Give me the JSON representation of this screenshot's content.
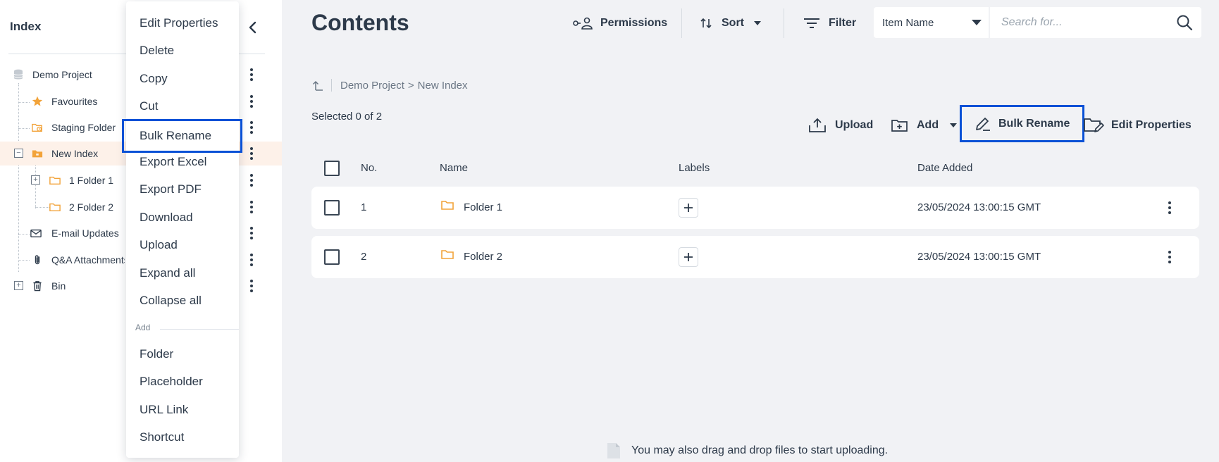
{
  "sidebar": {
    "title": "Index",
    "items": [
      {
        "label": "Demo Project"
      },
      {
        "label": "Favourites"
      },
      {
        "label": "Staging Folder"
      },
      {
        "label": "New Index"
      },
      {
        "label": "1 Folder 1"
      },
      {
        "label": "2 Folder 2"
      },
      {
        "label": "E-mail Updates"
      },
      {
        "label": "Q&A Attachments"
      },
      {
        "label": "Bin"
      }
    ]
  },
  "context_menu": {
    "items": [
      "Edit Properties",
      "Delete",
      "Copy",
      "Cut",
      "Bulk Rename",
      "Export Excel",
      "Export PDF",
      "Download",
      "Upload",
      "Expand all",
      "Collapse all"
    ],
    "add_section_label": "Add",
    "add_items": [
      "Folder",
      "Placeholder",
      "URL Link",
      "Shortcut"
    ]
  },
  "header": {
    "title": "Contents",
    "permissions_label": "Permissions",
    "sort_label": "Sort",
    "filter_label": "Filter",
    "search_field_value": "Item Name",
    "search_placeholder": "Search for..."
  },
  "breadcrumb": {
    "root": "Demo Project",
    "separator": ">",
    "current": "New Index"
  },
  "selection_text": "Selected 0 of 2",
  "actions": {
    "upload": "Upload",
    "add": "Add",
    "bulk_rename": "Bulk Rename",
    "edit_properties": "Edit Properties"
  },
  "table": {
    "columns": [
      "No.",
      "Name",
      "Labels",
      "Date Added"
    ],
    "rows": [
      {
        "no": "1",
        "name": "Folder 1",
        "date": "23/05/2024 13:00:15 GMT"
      },
      {
        "no": "2",
        "name": "Folder 2",
        "date": "23/05/2024 13:00:15 GMT"
      }
    ]
  },
  "dropzone_text": "You may also drag and drop files to start uploading.",
  "colors": {
    "highlight": "#0a51d6",
    "folder": "#f2a33a",
    "active_row": "#fdf1e9",
    "background": "#f1f2f5"
  }
}
